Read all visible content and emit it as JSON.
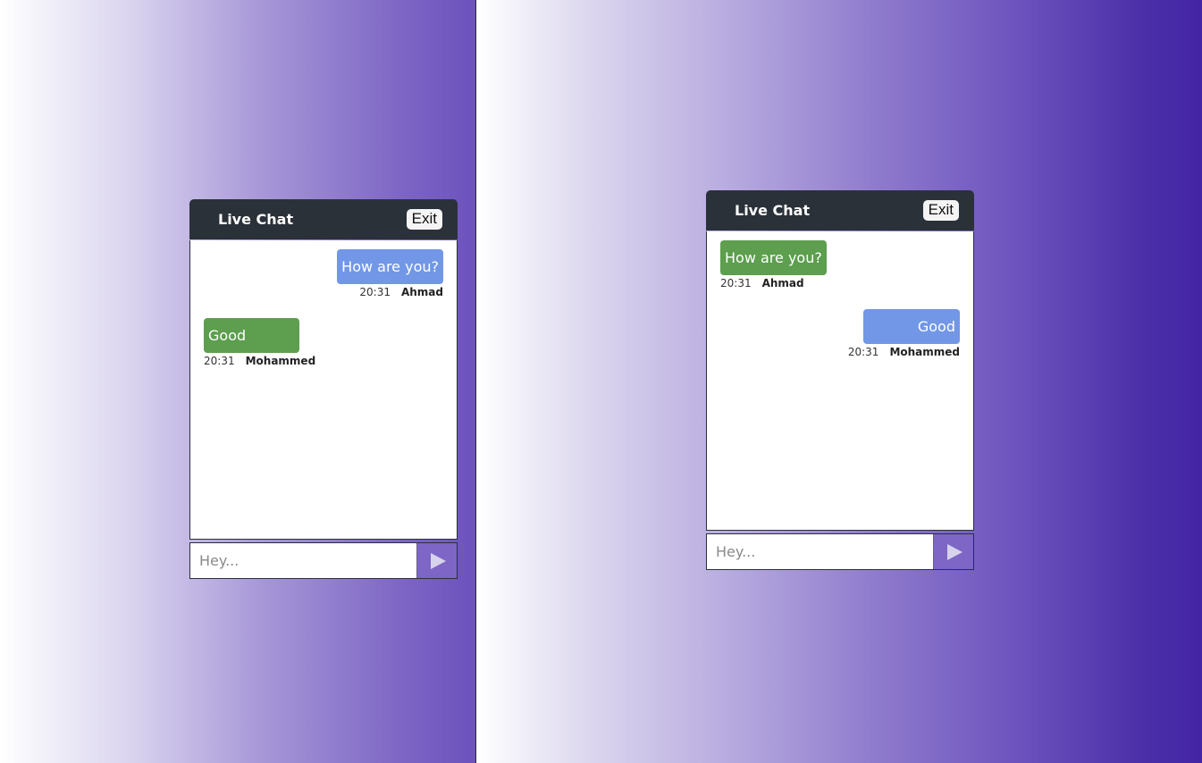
{
  "left_window": {
    "chat": {
      "title": "Live Chat",
      "exit_label": "Exit",
      "messages": [
        {
          "text": "How are you?",
          "time": "20:31",
          "sender": "Ahmad",
          "side": "outgoing",
          "color": "#7197e6"
        },
        {
          "text": "Good",
          "time": "20:31",
          "sender": "Mohammed",
          "side": "incoming",
          "color": "#5d9e4f"
        }
      ],
      "input_placeholder": "Hey...",
      "send_icon": "send-triangle-icon"
    }
  },
  "right_window": {
    "chat": {
      "title": "Live Chat",
      "exit_label": "Exit",
      "messages": [
        {
          "text": "How are you?",
          "time": "20:31",
          "sender": "Ahmad",
          "side": "incoming",
          "color": "#5d9e4f"
        },
        {
          "text": "Good",
          "time": "20:31",
          "sender": "Mohammed",
          "side": "outgoing",
          "color": "#7197e6"
        }
      ],
      "input_placeholder": "Hey...",
      "send_icon": "send-triangle-icon"
    }
  },
  "colors": {
    "header_bg": "#2b3139",
    "outgoing_bubble": "#7197e6",
    "incoming_bubble": "#5d9e4f",
    "send_button": "#7d66c5"
  }
}
